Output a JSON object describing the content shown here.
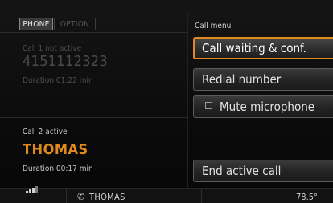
{
  "tabs": {
    "phone": "PHONE",
    "option": "OPTION"
  },
  "call1": {
    "status": "Call 1 not active",
    "number": "4151112323",
    "duration": "Duration 01:22 min"
  },
  "call2": {
    "status": "Call 2 active",
    "name": "THOMAS",
    "duration": "Duration 00:17 min"
  },
  "menu": {
    "title": "Call menu",
    "items": [
      {
        "label": "Call waiting & conf.",
        "selected": true
      },
      {
        "label": "Redial number"
      },
      {
        "label": "Mute microphone",
        "checked": false
      },
      {
        "label": "End active call"
      }
    ]
  },
  "status_bar": {
    "signal_icon": "signal-strength-icon",
    "phone_icon": "handset-icon",
    "caller": "THOMAS",
    "frequency": "78.5°"
  },
  "colors": {
    "accent": "#e08a1e",
    "background": "#0a0a0a"
  }
}
